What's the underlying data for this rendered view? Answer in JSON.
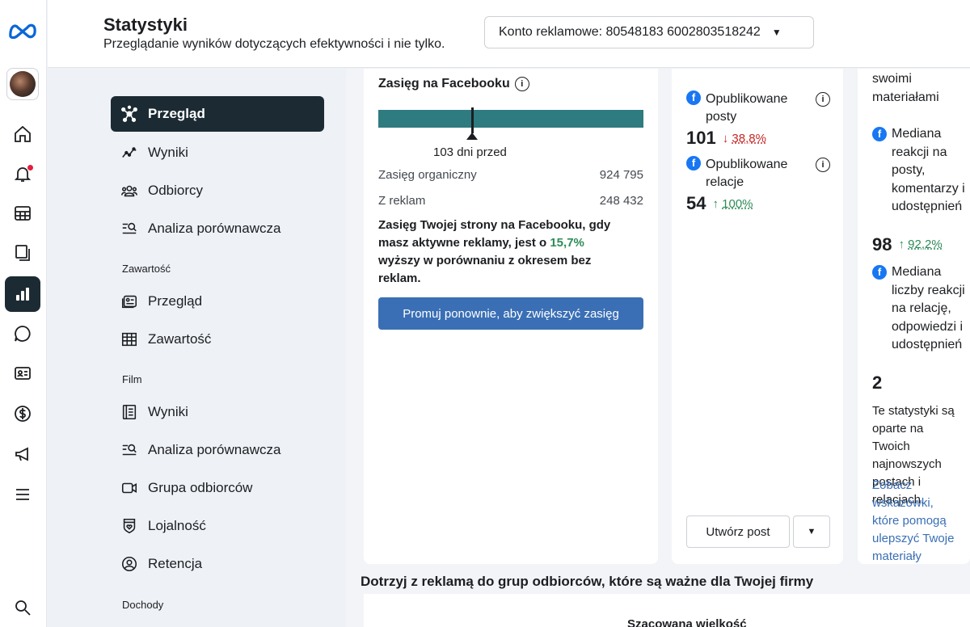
{
  "header": {
    "title": "Statystyki",
    "subtitle": "Przeglądanie wyników dotyczących efektywności i nie tylko.",
    "account_label": "Konto reklamowe: 80548183 6002803518242"
  },
  "nav": {
    "items": [
      {
        "label": "Przegląd",
        "icon": "overview-icon"
      },
      {
        "label": "Wyniki",
        "icon": "trend-icon"
      },
      {
        "label": "Odbiorcy",
        "icon": "audience-icon"
      },
      {
        "label": "Analiza porównawcza",
        "icon": "benchmark-icon"
      }
    ],
    "sections": [
      {
        "title": "Zawartość",
        "items": [
          {
            "label": "Przegląd"
          },
          {
            "label": "Zawartość"
          }
        ]
      },
      {
        "title": "Film",
        "items": [
          {
            "label": "Wyniki"
          },
          {
            "label": "Analiza porównawcza"
          },
          {
            "label": "Grupa odbiorców"
          },
          {
            "label": "Lojalność"
          },
          {
            "label": "Retencja"
          }
        ]
      },
      {
        "title": "Dochody"
      }
    ]
  },
  "reach": {
    "title": "Zasięg na Facebooku",
    "marker_label": "103 dni przed",
    "organic_label": "Zasięg organiczny",
    "organic_value": "924 795",
    "ads_label": "Z reklam",
    "ads_value": "248 432",
    "desc_pre": "Zasięg Twojej strony na Facebooku, gdy masz aktywne reklamy, jest o ",
    "desc_pct": "15,7%",
    "desc_post": " wyższy w porównaniu z okresem bez reklam.",
    "promote_button": "Promuj ponownie, aby zwiększyć zasięg"
  },
  "metrics": [
    {
      "label": "Opublikowane posty",
      "value": "101",
      "change": "38,8%",
      "direction": "down"
    },
    {
      "label": "Opublikowane relacje",
      "value": "54",
      "change": "100%",
      "direction": "up"
    }
  ],
  "create_post_button": "Utwórz post",
  "card3": {
    "heading": "swoimi materiałami",
    "m1_label": "Mediana reakcji na posty, komentarzy i udostępnień",
    "m1_value": "98",
    "m1_change": "92,2%",
    "m2_label": "Mediana liczby reakcji na relację, odpowiedzi i udostępnień",
    "m2_value": "2",
    "note": "Te statystyki są oparte na Twoich najnowszych postach i relacjach.",
    "link": "Zobacz wskazówki, które pomogą ulepszyć Twoje materiały"
  },
  "bottom": {
    "section_title": "Dotrzyj z reklamą do grup odbiorców, które są ważne dla Twojej firmy",
    "partial_label": "Szacowana wielkość"
  },
  "colors": {
    "accent": "#1c2b33",
    "bar": "#2e7b80",
    "button": "#3a6fb5",
    "up": "#2e8b57",
    "down": "#c62828"
  }
}
